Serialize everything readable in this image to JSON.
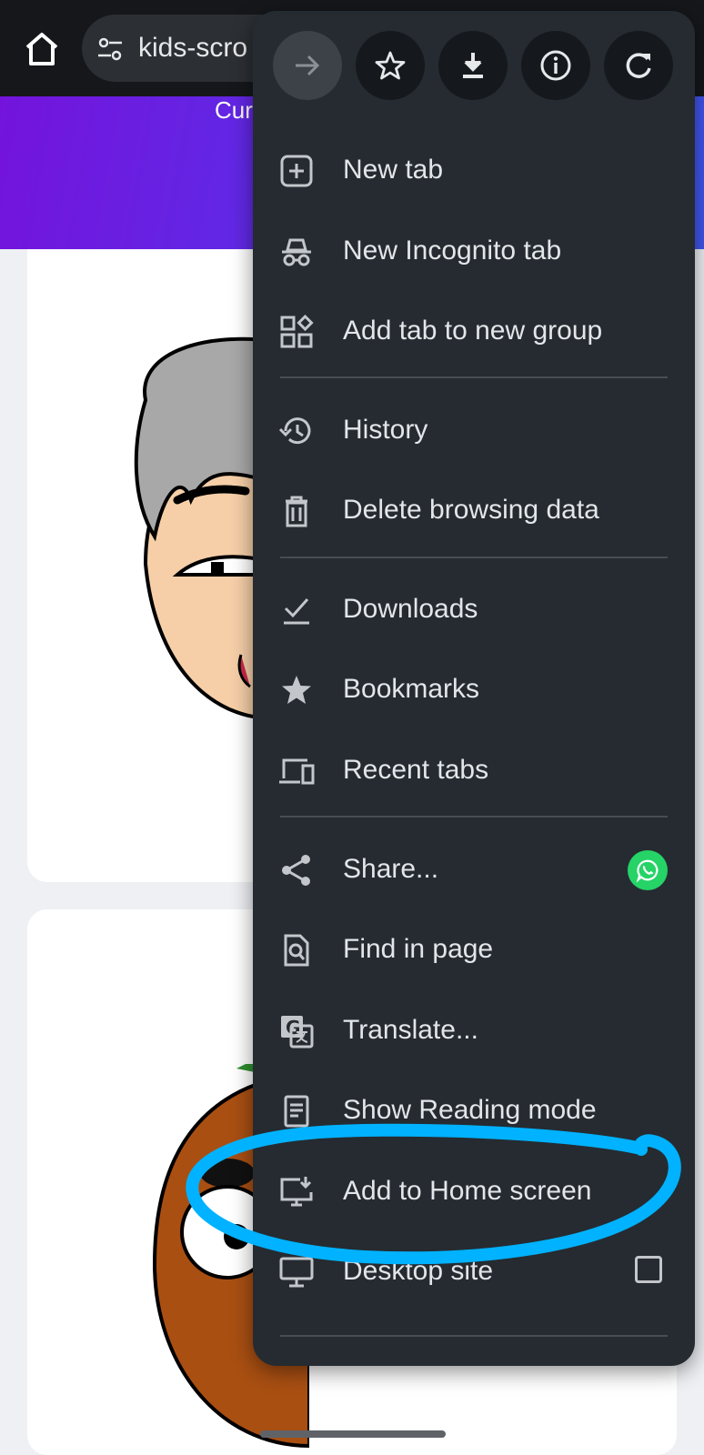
{
  "browser": {
    "url_text": "kids-scro",
    "home_icon": "home-icon",
    "site_settings_icon": "tune-icon"
  },
  "page": {
    "hero_text": "Cur"
  },
  "menu": {
    "top_icons": [
      "forward-icon",
      "star-icon",
      "download-icon",
      "info-icon",
      "refresh-icon"
    ],
    "items": [
      {
        "label": "New tab",
        "icon": "new-tab-icon"
      },
      {
        "label": "New Incognito tab",
        "icon": "incognito-icon"
      },
      {
        "label": "Add tab to new group",
        "icon": "tab-group-icon"
      },
      {
        "label": "History",
        "icon": "history-icon"
      },
      {
        "label": "Delete browsing data",
        "icon": "trash-icon"
      },
      {
        "label": "Downloads",
        "icon": "downloads-icon"
      },
      {
        "label": "Bookmarks",
        "icon": "bookmark-star-icon"
      },
      {
        "label": "Recent tabs",
        "icon": "devices-icon"
      },
      {
        "label": "Share...",
        "icon": "share-icon",
        "accessory": "whatsapp-icon"
      },
      {
        "label": "Find in page",
        "icon": "find-in-page-icon"
      },
      {
        "label": "Translate...",
        "icon": "translate-icon"
      },
      {
        "label": "Show Reading mode",
        "icon": "reading-mode-icon"
      },
      {
        "label": "Add to Home screen",
        "icon": "add-to-home-icon"
      },
      {
        "label": "Desktop site",
        "icon": "desktop-icon",
        "checked": false
      }
    ]
  },
  "colors": {
    "menu_bg": "#252b31",
    "highlight_annotation": "#00b2ff",
    "hero_gradient_start": "#7413dc",
    "hero_gradient_end": "#3f57ee",
    "whatsapp": "#25d366"
  }
}
